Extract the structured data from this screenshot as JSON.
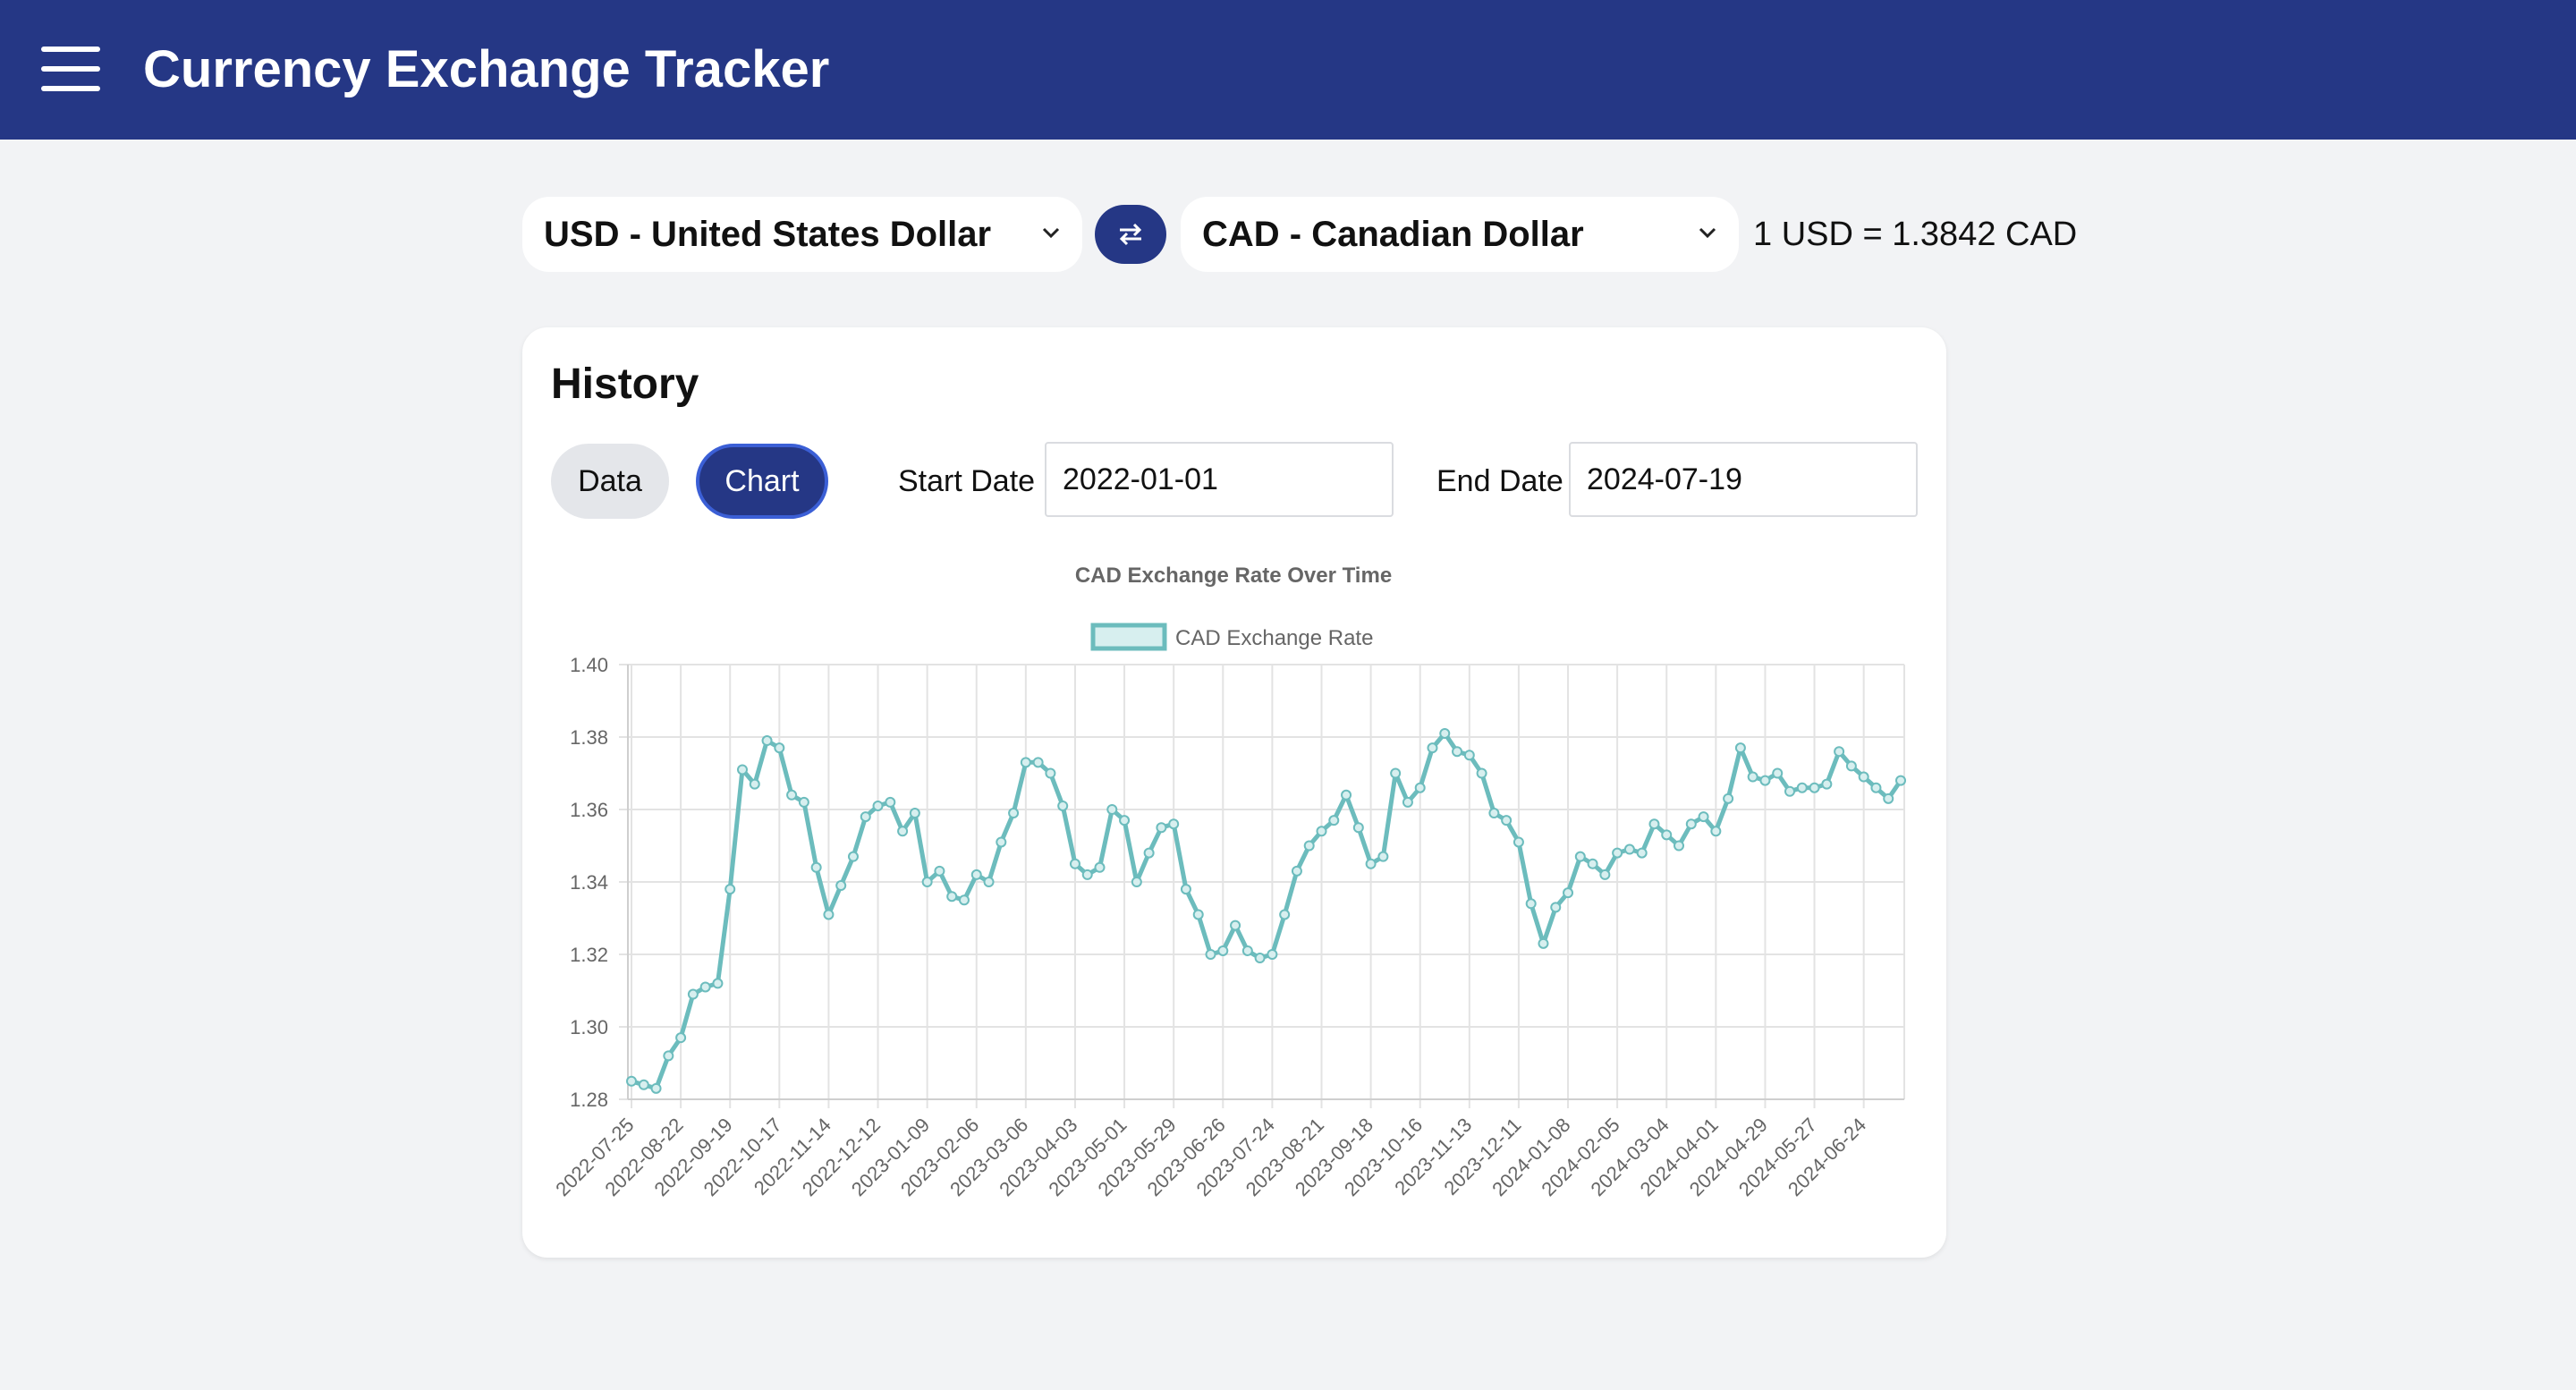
{
  "header": {
    "title": "Currency Exchange Tracker",
    "menu_icon": "hamburger-menu-icon"
  },
  "converter": {
    "from_currency": "USD - United States Dollar",
    "to_currency": "CAD - Canadian Dollar",
    "swap_icon": "swap-arrows-icon",
    "rate_text": "1 USD = 1.3842 CAD"
  },
  "history": {
    "title": "History",
    "tabs": {
      "data_label": "Data",
      "chart_label": "Chart",
      "active": "Chart"
    },
    "start_date_label": "Start Date",
    "start_date_value": "2022-01-01",
    "end_date_label": "End Date",
    "end_date_value": "2024-07-19"
  },
  "colors": {
    "brand": "#253785",
    "series_line": "#6cbcbd",
    "series_fill": "#d7efef"
  },
  "chart_data": {
    "type": "line",
    "title": "CAD Exchange Rate Over Time",
    "xlabel": "",
    "ylabel": "",
    "ylim": [
      1.28,
      1.4
    ],
    "yticks": [
      "1.40",
      "1.38",
      "1.36",
      "1.34",
      "1.32",
      "1.30",
      "1.28"
    ],
    "grid": true,
    "legend_position": "top-center",
    "x_tick_labels": [
      "2022-07-25",
      "2022-08-22",
      "2022-09-19",
      "2022-10-17",
      "2022-11-14",
      "2022-12-12",
      "2023-01-09",
      "2023-02-06",
      "2023-03-06",
      "2023-04-03",
      "2023-05-01",
      "2023-05-29",
      "2023-06-26",
      "2023-07-24",
      "2023-08-21",
      "2023-09-18",
      "2023-10-16",
      "2023-11-13",
      "2023-12-11",
      "2024-01-08",
      "2024-02-05",
      "2024-03-04",
      "2024-04-01",
      "2024-04-29",
      "2024-05-27",
      "2024-06-24"
    ],
    "series": [
      {
        "name": "CAD Exchange Rate",
        "x_start": "2022-07-25",
        "x_step_days": 7,
        "values": [
          1.285,
          1.284,
          1.283,
          1.292,
          1.297,
          1.309,
          1.311,
          1.312,
          1.338,
          1.371,
          1.367,
          1.379,
          1.377,
          1.364,
          1.362,
          1.344,
          1.331,
          1.339,
          1.347,
          1.358,
          1.361,
          1.362,
          1.354,
          1.359,
          1.34,
          1.343,
          1.336,
          1.335,
          1.342,
          1.34,
          1.351,
          1.359,
          1.373,
          1.373,
          1.37,
          1.361,
          1.345,
          1.342,
          1.344,
          1.36,
          1.357,
          1.34,
          1.348,
          1.355,
          1.356,
          1.338,
          1.331,
          1.32,
          1.321,
          1.328,
          1.321,
          1.319,
          1.32,
          1.331,
          1.343,
          1.35,
          1.354,
          1.357,
          1.364,
          1.355,
          1.345,
          1.347,
          1.37,
          1.362,
          1.366,
          1.377,
          1.381,
          1.376,
          1.375,
          1.37,
          1.359,
          1.357,
          1.351,
          1.334,
          1.323,
          1.333,
          1.337,
          1.347,
          1.345,
          1.342,
          1.348,
          1.349,
          1.348,
          1.356,
          1.353,
          1.35,
          1.356,
          1.358,
          1.354,
          1.363,
          1.377,
          1.369,
          1.368,
          1.37,
          1.365,
          1.366,
          1.366,
          1.367,
          1.376,
          1.372,
          1.369,
          1.366,
          1.363,
          1.368
        ]
      }
    ]
  }
}
